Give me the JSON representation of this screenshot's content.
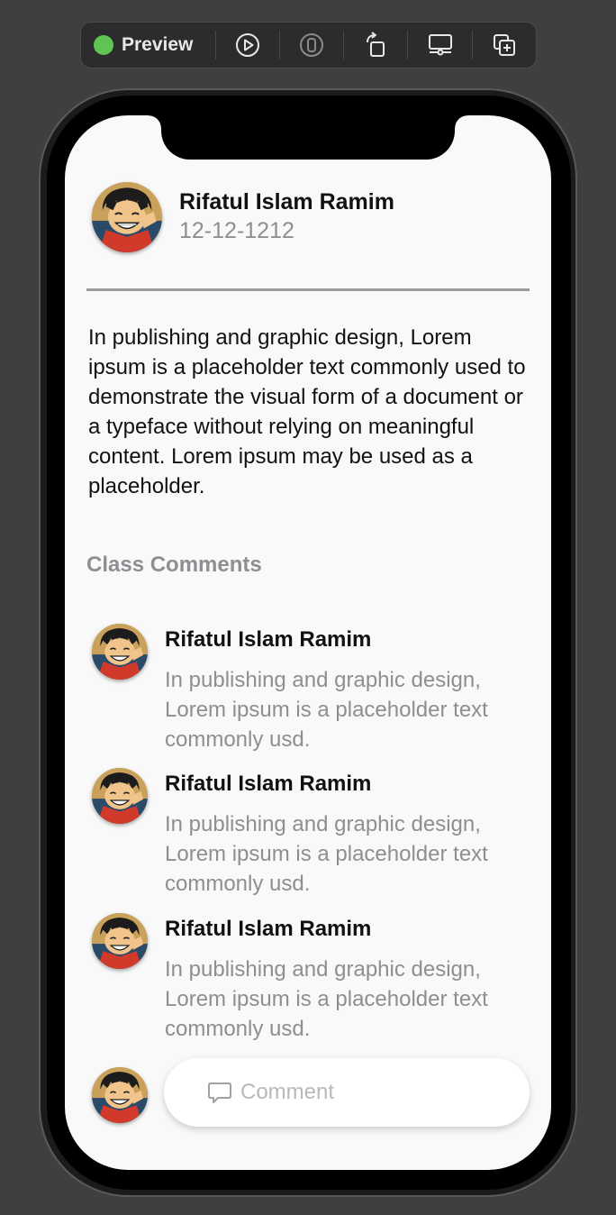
{
  "toolbar": {
    "preview_label": "Preview",
    "status_color": "#5ec452",
    "buttons": [
      "play-icon",
      "device-icon",
      "rotate-icon",
      "monitor-icon",
      "duplicate-icon"
    ]
  },
  "profile": {
    "name": "Rifatul Islam Ramim",
    "date": "12-12-1212"
  },
  "description": "In publishing and graphic design, Lorem ipsum is a placeholder text commonly used to demonstrate the visual form of a document or a typeface without relying on meaningful content. Lorem ipsum may be used as a placeholder.",
  "comments_section": {
    "title": "Class Comments",
    "items": [
      {
        "name": "Rifatul Islam Ramim",
        "text": "In publishing and graphic design, Lorem ipsum is a placeholder text commonly usd."
      },
      {
        "name": "Rifatul Islam Ramim",
        "text": "In publishing and graphic design, Lorem ipsum is a placeholder text commonly usd."
      },
      {
        "name": "Rifatul Islam Ramim",
        "text": "In publishing and graphic design, Lorem ipsum is a placeholder text commonly usd."
      }
    ]
  },
  "comment_input": {
    "placeholder": "Comment",
    "icon": "comment-bubble-icon"
  }
}
